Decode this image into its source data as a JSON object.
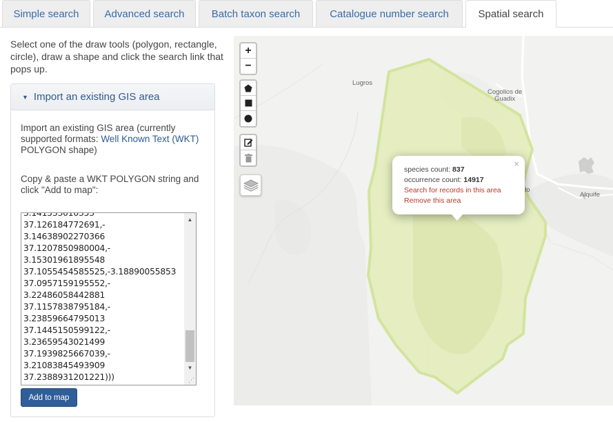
{
  "tabs": [
    {
      "label": "Simple search"
    },
    {
      "label": "Advanced search"
    },
    {
      "label": "Batch taxon search"
    },
    {
      "label": "Catalogue number search"
    },
    {
      "label": "Spatial search"
    }
  ],
  "active_tab": "Spatial search",
  "intro": "Select one of the draw tools (polygon, rectangle, circle), draw a shape and click the search link that pops up.",
  "panel": {
    "title": "Import an existing GIS area",
    "desc_prefix": "Import an existing GIS area (currently supported formats: ",
    "desc_link": "Well Known Text (WKT)",
    "desc_suffix": " POLYGON shape)",
    "paste_instruction": "Copy & paste a WKT POLYGON string and click \"Add to map\":",
    "wkt_value": "3.141533010353\n37.126184772691,-\n3.14638902270366\n37.1207850980004,-\n3.15301961895548\n37.1055454585525,-3.18890055853\n37.0957159195552,-\n3.22486058442881\n37.1157838795184,-\n3.23859664795013\n37.1445150599122,-\n3.23659543021499\n37.1939825667039,-\n3.21083845493909\n37.2388931201221)))",
    "add_button": "Add to map"
  },
  "map": {
    "zoom_in": "+",
    "zoom_out": "−",
    "draw_tools": [
      "polygon-tool",
      "rectangle-tool",
      "circle-tool"
    ],
    "edit_tools": [
      "edit-tool",
      "delete-tool"
    ],
    "places": {
      "lugros": "Lugros",
      "cogollos": "Cogollos de\nGuadix",
      "alquife": "Alquife",
      "partial": "do"
    },
    "polygon_fill": "#e3ecb9",
    "polygon_stroke": "#d4e39e",
    "popup": {
      "species_label": "species count:",
      "species_count": "837",
      "occurrence_label": "occurrence count:",
      "occurrence_count": "14917",
      "search_link": "Search for records in this area",
      "remove_link": "Remove this area",
      "close": "×"
    }
  },
  "colors": {
    "link": "#2e5a93",
    "button": "#2f5e99",
    "popup_link": "#b5382a"
  }
}
